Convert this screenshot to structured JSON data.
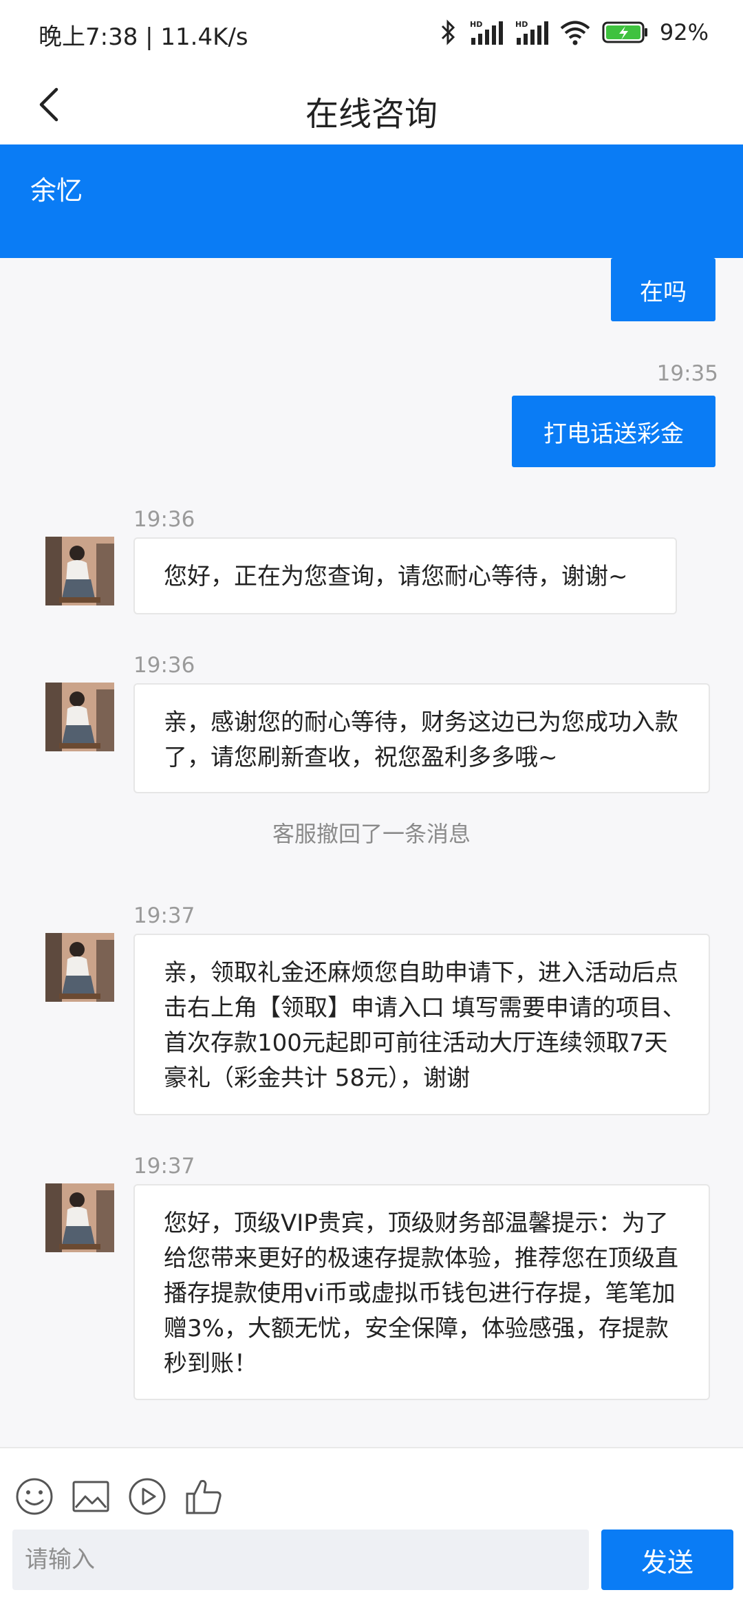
{
  "status": {
    "time": "晚上7:38 | 11.4K/s",
    "battery_pct": "92%"
  },
  "header": {
    "title": "在线咨询"
  },
  "banner": {
    "name": "余忆"
  },
  "messages": {
    "out1": {
      "text": "在吗"
    },
    "out2": {
      "time": "19:35",
      "text": "打电话送彩金"
    },
    "in1": {
      "time": "19:36",
      "text": "您好，正在为您查询，请您耐心等待，谢谢~"
    },
    "in2": {
      "time": "19:36",
      "text": "亲，感谢您的耐心等待，财务这边已为您成功入款了，请您刷新查收，祝您盈利多多哦~"
    },
    "recall_note": "客服撤回了一条消息",
    "in3": {
      "time": "19:37",
      "text": "亲，领取礼金还麻烦您自助申请下，进入活动后点击右上角【领取】申请入口 填写需要申请的项目、首次存款100元起即可前往活动大厅连续领取7天豪礼（彩金共计 58元），谢谢"
    },
    "in4": {
      "time": "19:37",
      "text": "您好，顶级VIP贵宾，顶级财务部温馨提示：为了给您带来更好的极速存提款体验，推荐您在顶级直播存提款使用vi币或虚拟币钱包进行存提，笔笔加赠3%，大额无忧，安全保障，体验感强，存提款秒到账！"
    }
  },
  "input": {
    "placeholder": "请输入",
    "value": ""
  },
  "send_label": "发送",
  "icons": [
    "bluetooth-icon",
    "signal-icon",
    "wifi-icon",
    "battery-icon",
    "back-icon",
    "emoji-icon",
    "image-icon",
    "video-icon",
    "thumbs-up-icon"
  ],
  "colors": {
    "accent": "#0a7cf5",
    "background": "#f7f7f9",
    "battery_green": "#3fc23f"
  }
}
